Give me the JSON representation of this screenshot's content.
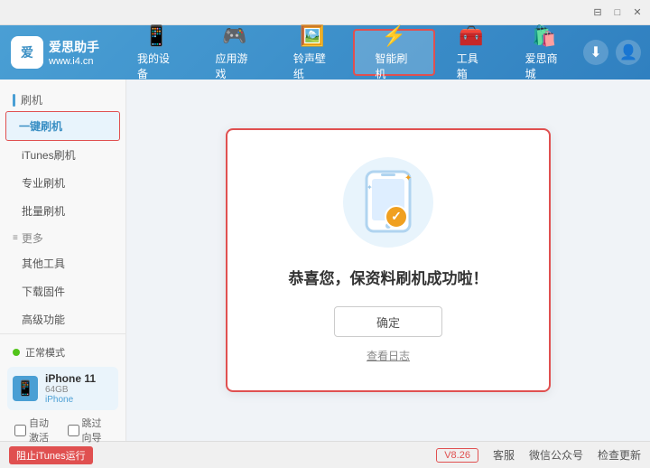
{
  "titlebar": {
    "buttons": [
      "minimize",
      "maximize",
      "close"
    ],
    "icons": [
      "⊟",
      "□",
      "✕"
    ]
  },
  "navbar": {
    "logo": {
      "icon": "爱",
      "line1": "爱思助手",
      "line2": "www.i4.cn"
    },
    "tabs": [
      {
        "id": "my-device",
        "label": "我的设备",
        "icon": "📱"
      },
      {
        "id": "apps-games",
        "label": "应用游戏",
        "icon": "🎮"
      },
      {
        "id": "ringtones",
        "label": "铃声壁纸",
        "icon": "🖼️"
      },
      {
        "id": "smart-flash",
        "label": "智能刷机",
        "icon": "⚡",
        "active": true
      },
      {
        "id": "toolbox",
        "label": "工具箱",
        "icon": "🧰"
      },
      {
        "id": "store",
        "label": "爱思商城",
        "icon": "🛍️"
      }
    ],
    "action_download": "⬇",
    "action_user": "👤"
  },
  "sidebar": {
    "section_flash": "刷机",
    "items": [
      {
        "id": "one-click",
        "label": "一键刷机",
        "active": true
      },
      {
        "id": "itunes-flash",
        "label": "iTunes刷机",
        "active": false
      },
      {
        "id": "pro-flash",
        "label": "专业刷机",
        "active": false
      },
      {
        "id": "batch-flash",
        "label": "批量刷机",
        "active": false
      }
    ],
    "section_more": "更多",
    "more_items": [
      {
        "id": "other-tools",
        "label": "其他工具"
      },
      {
        "id": "download-firmware",
        "label": "下载固件"
      },
      {
        "id": "advanced",
        "label": "高级功能"
      }
    ],
    "device_mode_label": "正常模式",
    "device_name": "iPhone 11",
    "device_storage": "64GB",
    "device_type": "iPhone",
    "checkbox_auto": "自动激活",
    "checkbox_guide": "跳过向导"
  },
  "content": {
    "success_title": "恭喜您，保资料刷机成功啦！",
    "confirm_btn": "确定",
    "history_link": "查看日志"
  },
  "footer": {
    "stop_label": "阻止iTunes运行",
    "version": "V8.26",
    "service": "客服",
    "wechat": "微信公众号",
    "check_update": "检查更新"
  }
}
